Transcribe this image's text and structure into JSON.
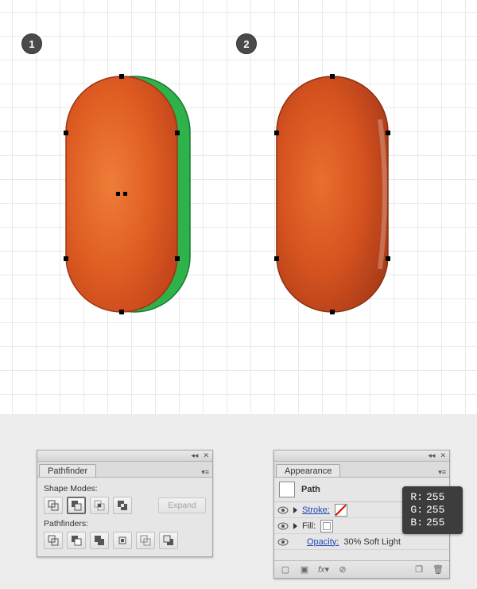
{
  "steps": {
    "s1": "1",
    "s2": "2"
  },
  "pathfinder": {
    "tab": "Pathfinder",
    "shape_modes_label": "Shape Modes:",
    "pathfinders_label": "Pathfinders:",
    "expand_label": "Expand",
    "shape_mode_buttons": [
      "unite",
      "minus-front",
      "intersect",
      "exclude"
    ],
    "pathfinder_buttons": [
      "divide",
      "trim",
      "merge",
      "crop",
      "outline",
      "minus-back"
    ]
  },
  "appearance": {
    "tab": "Appearance",
    "object_name": "Path",
    "rows": {
      "stroke_label": "Stroke:",
      "fill_label": "Fill:",
      "opacity_label": "Opacity:",
      "opacity_value": "30% Soft Light"
    }
  },
  "rgb": {
    "r_label": "R:",
    "r": "255",
    "g_label": "G:",
    "g": "255",
    "b_label": "B:",
    "b": "255"
  },
  "colors": {
    "orange_a": "#e86a28",
    "orange_b": "#c8451a",
    "green": "#2fb24a",
    "badge": "#4a4a4a"
  }
}
